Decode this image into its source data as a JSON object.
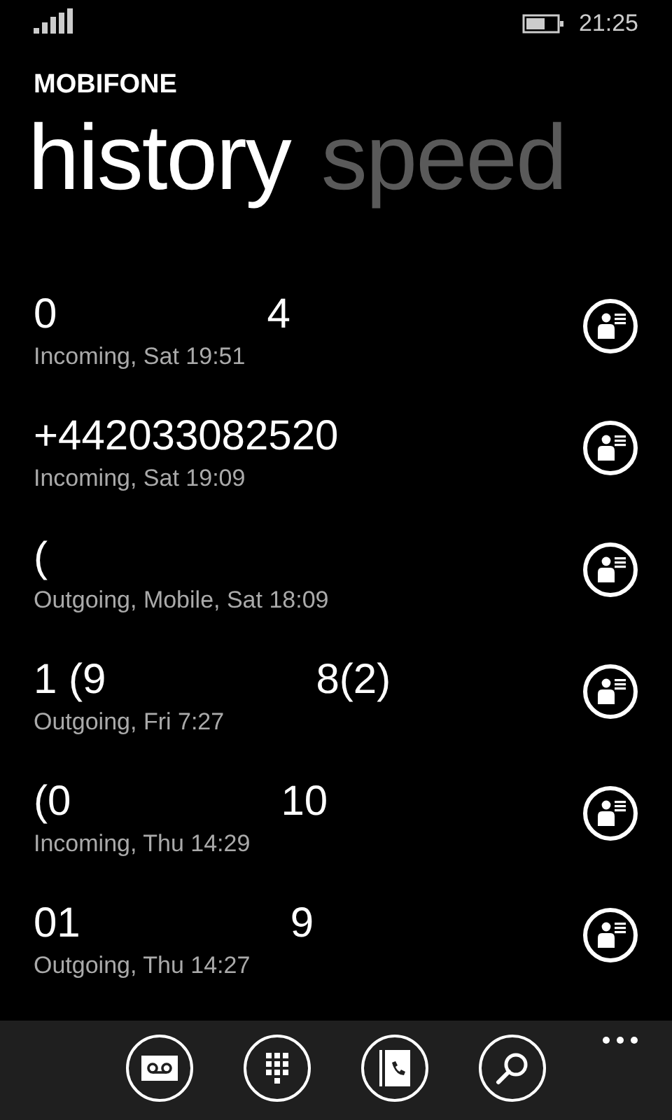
{
  "status_bar": {
    "time": "21:25"
  },
  "app_title": "MOBIFONE",
  "pivots": [
    {
      "label": "history",
      "selected": true
    },
    {
      "label": "speed",
      "selected": false
    }
  ],
  "calls": [
    {
      "number_parts": [
        "0",
        "4"
      ],
      "detail": "Incoming, Sat 19:51"
    },
    {
      "number_parts": [
        "+442033082520"
      ],
      "detail": "Incoming, Sat 19:09"
    },
    {
      "number_parts": [
        "("
      ],
      "detail": "Outgoing, Mobile, Sat 18:09"
    },
    {
      "number_parts": [
        "1 (9",
        "8(2)"
      ],
      "detail": "Outgoing, Fri 7:27"
    },
    {
      "number_parts": [
        "(0",
        "10"
      ],
      "detail": "Incoming, Thu 14:29"
    },
    {
      "number_parts": [
        "01",
        "9"
      ],
      "detail": "Outgoing, Thu 14:27"
    }
  ],
  "app_bar": {
    "buttons": [
      {
        "kind": "voicemail"
      },
      {
        "kind": "keypad"
      },
      {
        "kind": "contacts"
      },
      {
        "kind": "search"
      }
    ]
  }
}
